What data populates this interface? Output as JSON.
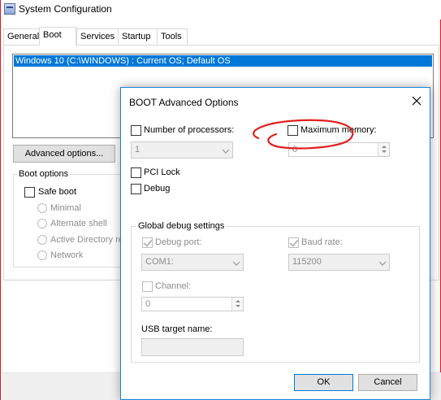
{
  "window": {
    "title": "System Configuration"
  },
  "tabs": [
    {
      "label": "General"
    },
    {
      "label": "Boot"
    },
    {
      "label": "Services"
    },
    {
      "label": "Startup"
    },
    {
      "label": "Tools"
    }
  ],
  "boot_tab": {
    "os_entries": [
      "Windows 10 (C:\\WINDOWS) : Current OS; Default OS"
    ],
    "advanced_options_label": "Advanced options...",
    "boot_options": {
      "title": "Boot options",
      "safe_boot_label": "Safe boot",
      "radio_minimal": "Minimal",
      "radio_alternate_shell": "Alternate shell",
      "radio_active_directory": "Active Directory re",
      "radio_network": "Network"
    }
  },
  "dialog": {
    "title": "BOOT Advanced Options",
    "num_processors_label": "Number of processors:",
    "num_processors_value": "1",
    "max_memory_label": "Maximum memory:",
    "max_memory_value": "0",
    "pci_lock_label": "PCI Lock",
    "debug_label": "Debug",
    "global_debug": {
      "title": "Global debug settings",
      "debug_port_label": "Debug port:",
      "debug_port_value": "COM1:",
      "baud_rate_label": "Baud rate:",
      "baud_rate_value": "115200",
      "channel_label": "Channel:",
      "channel_value": "0",
      "usb_target_label": "USB target name:"
    },
    "ok_label": "OK",
    "cancel_label": "Cancel"
  },
  "annotation": {
    "color": "#e0201f"
  },
  "colors": {
    "selection": "#0078d7",
    "window_border": "#e81123",
    "dialog_border": "#1883d7"
  }
}
